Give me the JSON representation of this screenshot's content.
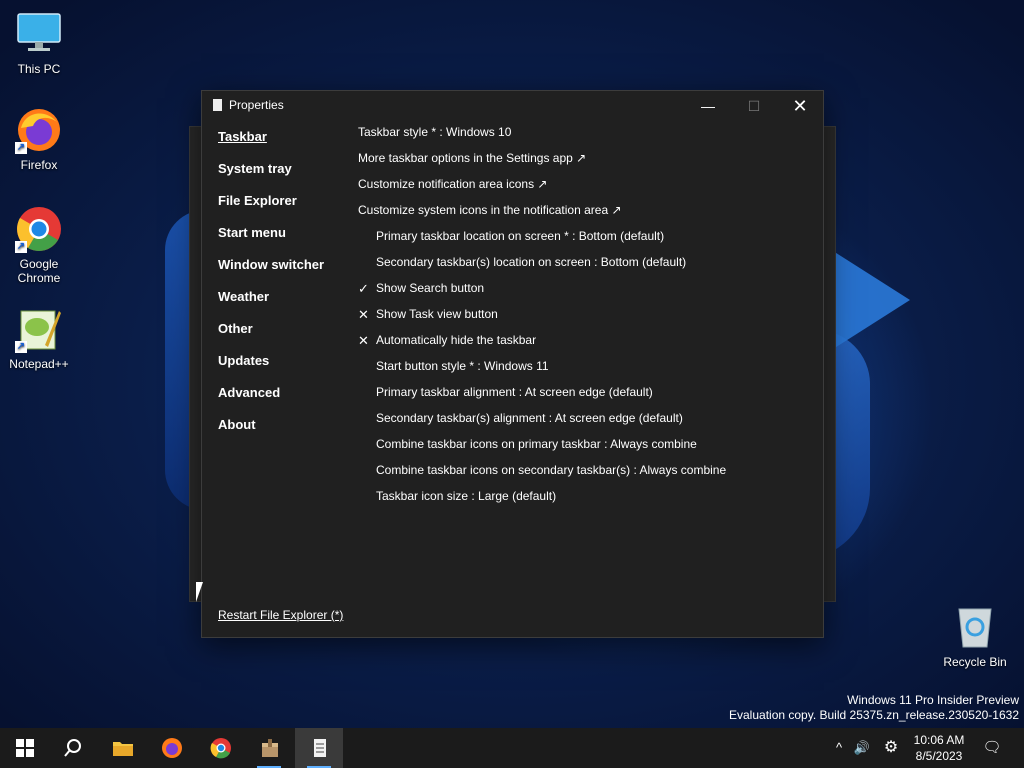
{
  "desktop": {
    "icons": [
      {
        "label": "This PC",
        "icon": "monitor-icon"
      },
      {
        "label": "Firefox",
        "icon": "firefox-icon"
      },
      {
        "label": "Google Chrome",
        "icon": "chrome-icon"
      },
      {
        "label": "Notepad++",
        "icon": "notepadpp-icon"
      },
      {
        "label": "Recycle Bin",
        "icon": "recycle-bin-icon"
      }
    ],
    "watermark": {
      "line1": "Windows 11 Pro Insider Preview",
      "line2": "Evaluation copy. Build 25375.zn_release.230520-1632"
    }
  },
  "window": {
    "title": "Properties",
    "controls": {
      "minimize": "—",
      "maximize": "☐",
      "close": "✕"
    },
    "nav": [
      {
        "label": "Taskbar",
        "active": true
      },
      {
        "label": "System tray"
      },
      {
        "label": "File Explorer"
      },
      {
        "label": "Start menu"
      },
      {
        "label": "Window switcher"
      },
      {
        "label": "Weather"
      },
      {
        "label": "Other"
      },
      {
        "label": "Updates"
      },
      {
        "label": "Advanced"
      },
      {
        "label": "About"
      }
    ],
    "settings": [
      {
        "text": "Taskbar style * : Windows 10",
        "mark": "",
        "indent": false
      },
      {
        "text": "More taskbar options in the Settings app ↗",
        "mark": "",
        "indent": false
      },
      {
        "text": "Customize notification area icons ↗",
        "mark": "",
        "indent": false
      },
      {
        "text": "Customize system icons in the notification area ↗",
        "mark": "",
        "indent": false
      },
      {
        "text": "Primary taskbar location on screen * : Bottom (default)",
        "mark": "",
        "indent": true
      },
      {
        "text": "Secondary taskbar(s) location on screen : Bottom (default)",
        "mark": "",
        "indent": true
      },
      {
        "text": "Show Search button",
        "mark": "✓",
        "indent": true
      },
      {
        "text": "Show Task view button",
        "mark": "✕",
        "indent": true
      },
      {
        "text": "Automatically hide the taskbar",
        "mark": "✕",
        "indent": true
      },
      {
        "text": "Start button style * : Windows 11",
        "mark": "",
        "indent": true
      },
      {
        "text": "Primary taskbar alignment : At screen edge (default)",
        "mark": "",
        "indent": true
      },
      {
        "text": "Secondary taskbar(s) alignment : At screen edge (default)",
        "mark": "",
        "indent": true
      },
      {
        "text": "Combine taskbar icons on primary taskbar : Always combine",
        "mark": "",
        "indent": true
      },
      {
        "text": "Combine taskbar icons on secondary taskbar(s) : Always combine",
        "mark": "",
        "indent": true
      },
      {
        "text": "Taskbar icon size : Large (default)",
        "mark": "",
        "indent": true
      }
    ],
    "restart_link": "Restart File Explorer (*)"
  },
  "taskbar": {
    "apps": [
      "start-icon",
      "search-icon",
      "file-explorer-icon",
      "firefox-icon",
      "chrome-icon",
      "package-icon",
      "properties-icon"
    ],
    "tray": {
      "chevron": "^",
      "volume": "🔊",
      "settings": "⚙",
      "notifications": "🗨"
    },
    "time": "10:06 AM",
    "date": "8/5/2023"
  }
}
